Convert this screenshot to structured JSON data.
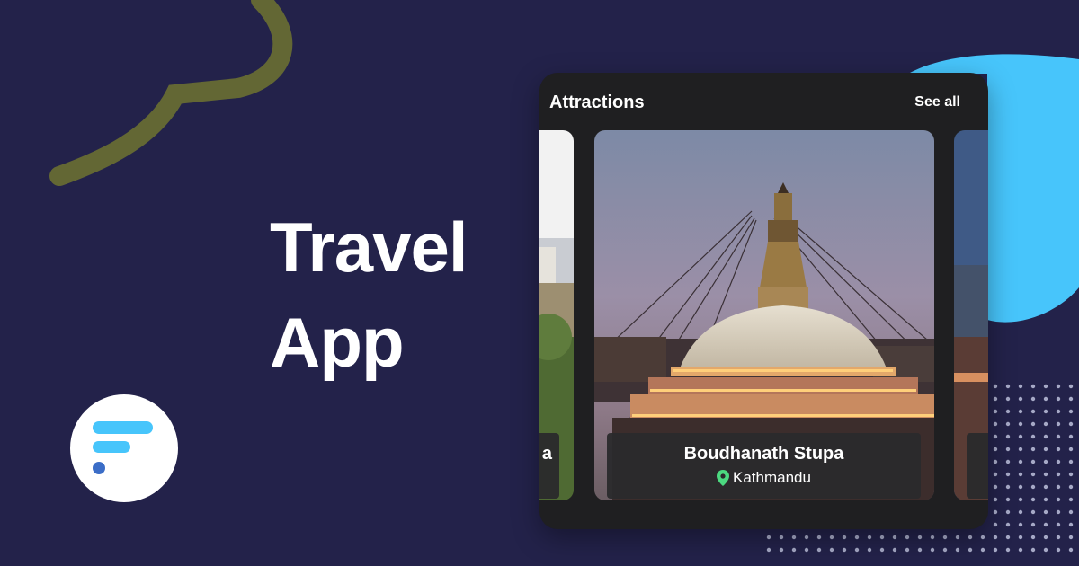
{
  "hero": {
    "title_line1": "Travel",
    "title_line2": "App"
  },
  "brand": {
    "logo_icon": "flutter-style-logo-icon",
    "colors": {
      "background": "#23224a",
      "accent_cyan": "#47c5fb",
      "accent_blue": "#3b6dc7",
      "olive": "#6b6b36"
    }
  },
  "attractions": {
    "section_title": "Attractions",
    "see_all_label": "See all",
    "cards": [
      {
        "name": "",
        "location": "",
        "partial_text": "a"
      },
      {
        "name": "Boudhanath Stupa",
        "location": "Kathmandu",
        "location_icon": "map-pin-icon"
      },
      {
        "name": "",
        "location": ""
      }
    ]
  }
}
